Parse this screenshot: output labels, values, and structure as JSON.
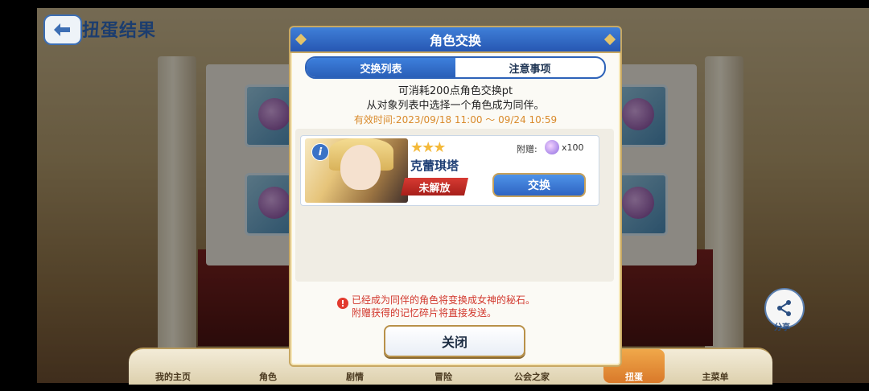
{
  "screen": {
    "page_title": "扭蛋结果",
    "share_label": "分享"
  },
  "bottom_nav": {
    "items": [
      {
        "label": "我的主页"
      },
      {
        "label": "角色"
      },
      {
        "label": "剧情"
      },
      {
        "label": "冒险"
      },
      {
        "label": "公会之家"
      },
      {
        "label": "扭蛋"
      },
      {
        "label": "主菜单"
      }
    ],
    "active_index": 5
  },
  "modal": {
    "title": "角色交换",
    "tabs": [
      {
        "label": "交换列表",
        "active": true
      },
      {
        "label": "注意事项",
        "active": false
      }
    ],
    "description_line1": "可消耗200点角色交换pt",
    "description_line2": "从对象列表中选择一个角色成为同伴。",
    "validity": "有效时间:2023/09/18 11:00 ～ 09/24 10:59",
    "character": {
      "stars": "★★★",
      "star_count": 3,
      "name": "克蕾琪塔",
      "status": "未解放",
      "bonus_label": "附赠:",
      "bonus_icon": "memory-shard-icon",
      "bonus_qty": "x100",
      "exchange_label": "交换"
    },
    "warning_line1": "已经成为同伴的角色将变换成女神的秘石。",
    "warning_line2": "附赠获得的记忆碎片将直接发送。",
    "close_label": "关闭"
  },
  "colors": {
    "header_blue": "#2d62b8",
    "warning_red": "#d2372c",
    "validity_orange": "#d98a2b",
    "gold_border": "#c8a862"
  }
}
